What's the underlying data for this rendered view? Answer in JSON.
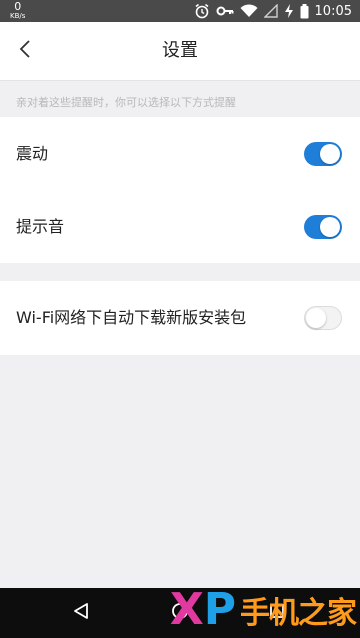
{
  "status_bar": {
    "net_speed": "0",
    "net_unit": "KB/s",
    "time": "10:05",
    "icons": [
      "alarm-icon",
      "key-icon",
      "wifi-icon",
      "signal-icon",
      "charging-icon",
      "battery-icon"
    ]
  },
  "header": {
    "title": "设置",
    "back_icon": "chevron-left-icon"
  },
  "hint_text": "亲对着这些提醒时，你可以选择以下方式提醒",
  "settings": [
    {
      "label": "震动",
      "enabled": true
    },
    {
      "label": "提示音",
      "enabled": true
    },
    {
      "label": "Wi-Fi网络下自动下载新版安装包",
      "enabled": false
    }
  ],
  "nav_bar": {
    "buttons": [
      "back-triangle-icon",
      "home-circle-icon",
      "recents-square-icon"
    ]
  },
  "watermark": {
    "logo": "XP",
    "text": "手机之家"
  },
  "colors": {
    "toggle_on": "#1e7ed8",
    "background": "#f0f0f2",
    "status_bar": "#4a4a4a"
  }
}
